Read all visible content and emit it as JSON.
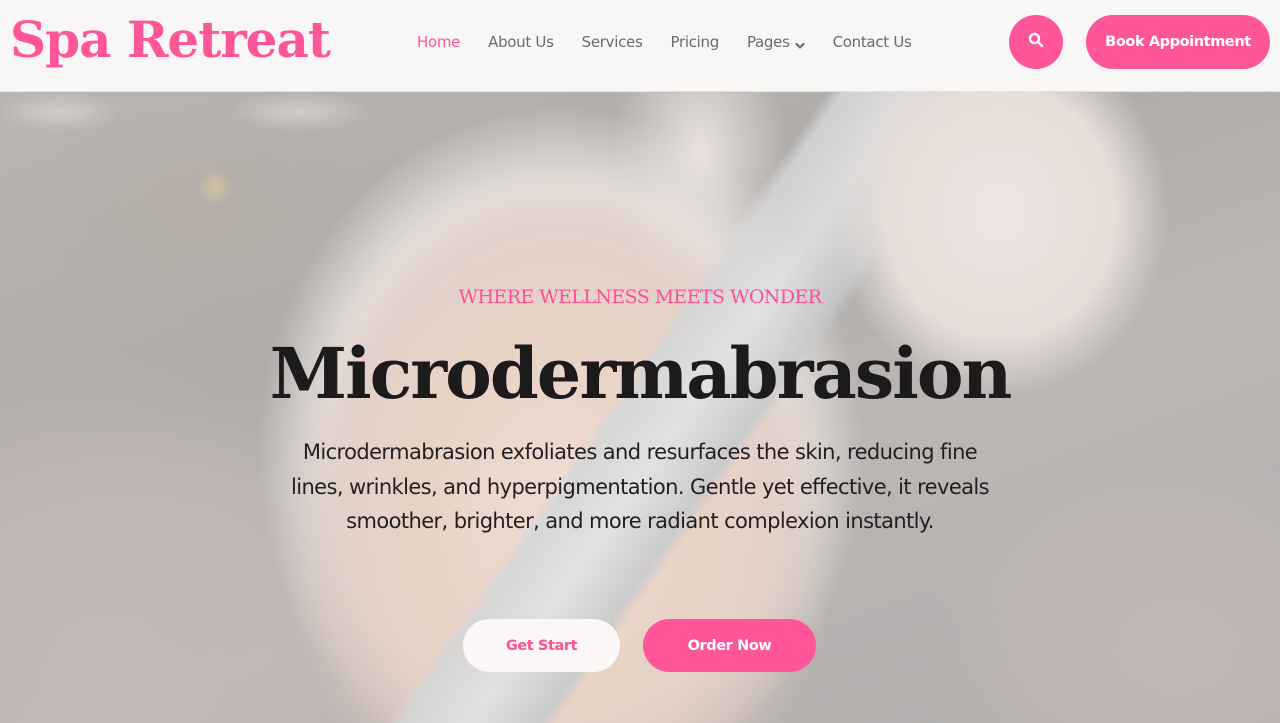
{
  "brand": {
    "name": "Spa Retreat",
    "accent_color": "#ff5599"
  },
  "nav": {
    "items": [
      {
        "label": "Home",
        "active": true
      },
      {
        "label": "About Us",
        "active": false
      },
      {
        "label": "Services",
        "active": false
      },
      {
        "label": "Pricing",
        "active": false
      },
      {
        "label": "Pages",
        "active": false,
        "has_dropdown": true
      },
      {
        "label": "Contact Us",
        "active": false
      }
    ],
    "search_icon": "search-icon",
    "dropdown_icon": "chevron-down-icon",
    "cta_label": "Book Appointment"
  },
  "hero": {
    "tagline": "WHERE WELLNESS MEETS WONDER",
    "title": "Microdermabrasion",
    "description": "Microdermabrasion exfoliates and resurfaces the skin, reducing fine lines, wrinkles, and hyperpigmentation. Gentle yet effective, it reveals smoother, brighter, and more radiant complexion instantly.",
    "background_image": "woman receiving microdermabrasion facial treatment",
    "primary_button": "Get Start",
    "secondary_button": "Order Now"
  }
}
